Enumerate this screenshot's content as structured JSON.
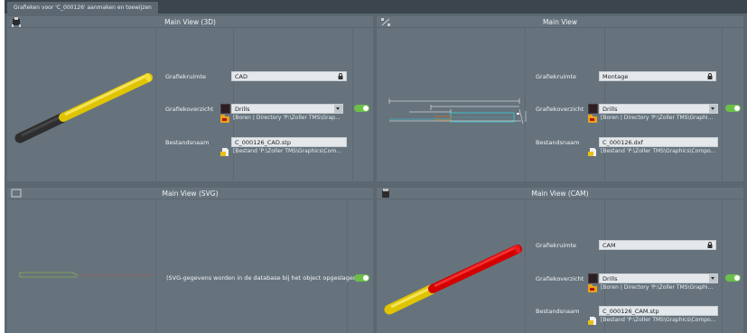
{
  "window_tab": "Grafieken voor 'C_000126' aanmaken en toewijzen",
  "labels": {
    "graphic_space": "Grafiekruimte",
    "graphic_overview": "Grafiekoverzicht",
    "filename": "Bestandsnaam"
  },
  "panels": {
    "main3d": {
      "title": "Main View (3D)",
      "space_value": "CAD",
      "overview_value": "Drills",
      "overview_path": "[Boren | Directory 'P:\\Zoller TMS\\Grap...",
      "file_value": "C_000126_CAD.stp",
      "file_path": "[Bestand 'P:\\Zoller TMS\\Graphics\\Com..."
    },
    "main": {
      "title": "Main View",
      "space_value": "Montage",
      "overview_value": "Drills",
      "overview_path": "[Boren | Directory 'P:\\Zoller TMS\\Graphi...",
      "file_value": "C_000126.dxf",
      "file_path": "[Bestand 'P:\\Zoller TMS\\Graphics\\Compo..."
    },
    "svg": {
      "title": "Main View (SVG)",
      "note": "(SVG-gegevens worden in de database bij het object opgeslagen)"
    },
    "cam": {
      "title": "Main View (CAM)",
      "space_value": "CAM",
      "overview_value": "Drills",
      "overview_path": "[Boren | Directory 'P:\\Zoller TMS\\Graphi...",
      "file_value": "C_000126_CAM.stp",
      "file_path": "[Bestand 'P:\\Zoller TMS\\Graphics\\Compo..."
    }
  },
  "colors": {
    "toggle_on": "#6cc04a",
    "tool_yellow": "#e0c400",
    "tool_dark": "#2e2e2e",
    "tool_red": "#d40000"
  }
}
